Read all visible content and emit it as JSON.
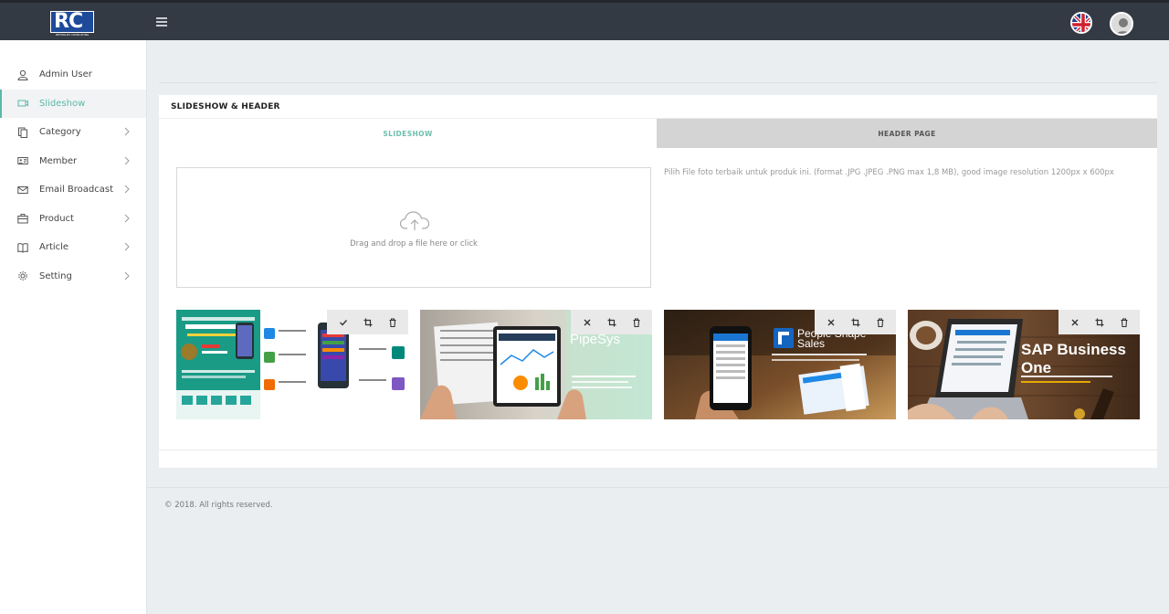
{
  "header": {
    "logo_text": "RC",
    "logo_subtext": "REYNOLDS CONSULTING",
    "language_icon": "uk-flag-icon",
    "profile_icon": "user-avatar-icon"
  },
  "sidebar": {
    "items": [
      {
        "label": "Admin User",
        "icon": "user-icon",
        "active": false,
        "has_children": false
      },
      {
        "label": "Slideshow",
        "icon": "slides-icon",
        "active": true,
        "has_children": false
      },
      {
        "label": "Category",
        "icon": "copy-icon",
        "active": false,
        "has_children": true
      },
      {
        "label": "Member",
        "icon": "id-card-icon",
        "active": false,
        "has_children": true
      },
      {
        "label": "Email Broadcast",
        "icon": "envelope-icon",
        "active": false,
        "has_children": true
      },
      {
        "label": "Product",
        "icon": "briefcase-icon",
        "active": false,
        "has_children": true
      },
      {
        "label": "Article",
        "icon": "book-icon",
        "active": false,
        "has_children": true
      },
      {
        "label": "Setting",
        "icon": "gear-icon",
        "active": false,
        "has_children": true
      }
    ]
  },
  "main": {
    "card_title": "SLIDESHOW & HEADER",
    "tabs": [
      {
        "label": "SLIDESHOW",
        "active": true
      },
      {
        "label": "HEADER PAGE",
        "active": false
      }
    ],
    "dropzone_text": "Drag and drop a file here or click",
    "hint": "Pilih File foto terbaik untuk produk ini. (format .JPG .JPEG .PNG max 1,8 MB), good image resolution 1200px x 600px",
    "slides": [
      {
        "name": "salesforce-infographic",
        "label": "",
        "tools": [
          "check",
          "crop",
          "delete"
        ]
      },
      {
        "name": "pipesys",
        "label": "PipeSys",
        "tools": [
          "close",
          "crop",
          "delete"
        ]
      },
      {
        "name": "people-shape-sales",
        "label": "People Shape Sales",
        "tools": [
          "close",
          "crop",
          "delete"
        ]
      },
      {
        "name": "sap-business-one",
        "label": "SAP Business One",
        "tools": [
          "close",
          "crop",
          "delete"
        ]
      }
    ]
  },
  "footer": {
    "copyright": "© 2018. All rights reserved."
  },
  "colors": {
    "topbar": "#343a44",
    "accent": "#5cb8a6",
    "tab_inactive_bg": "#d4d4d4",
    "page_bg": "#ebeef1"
  }
}
